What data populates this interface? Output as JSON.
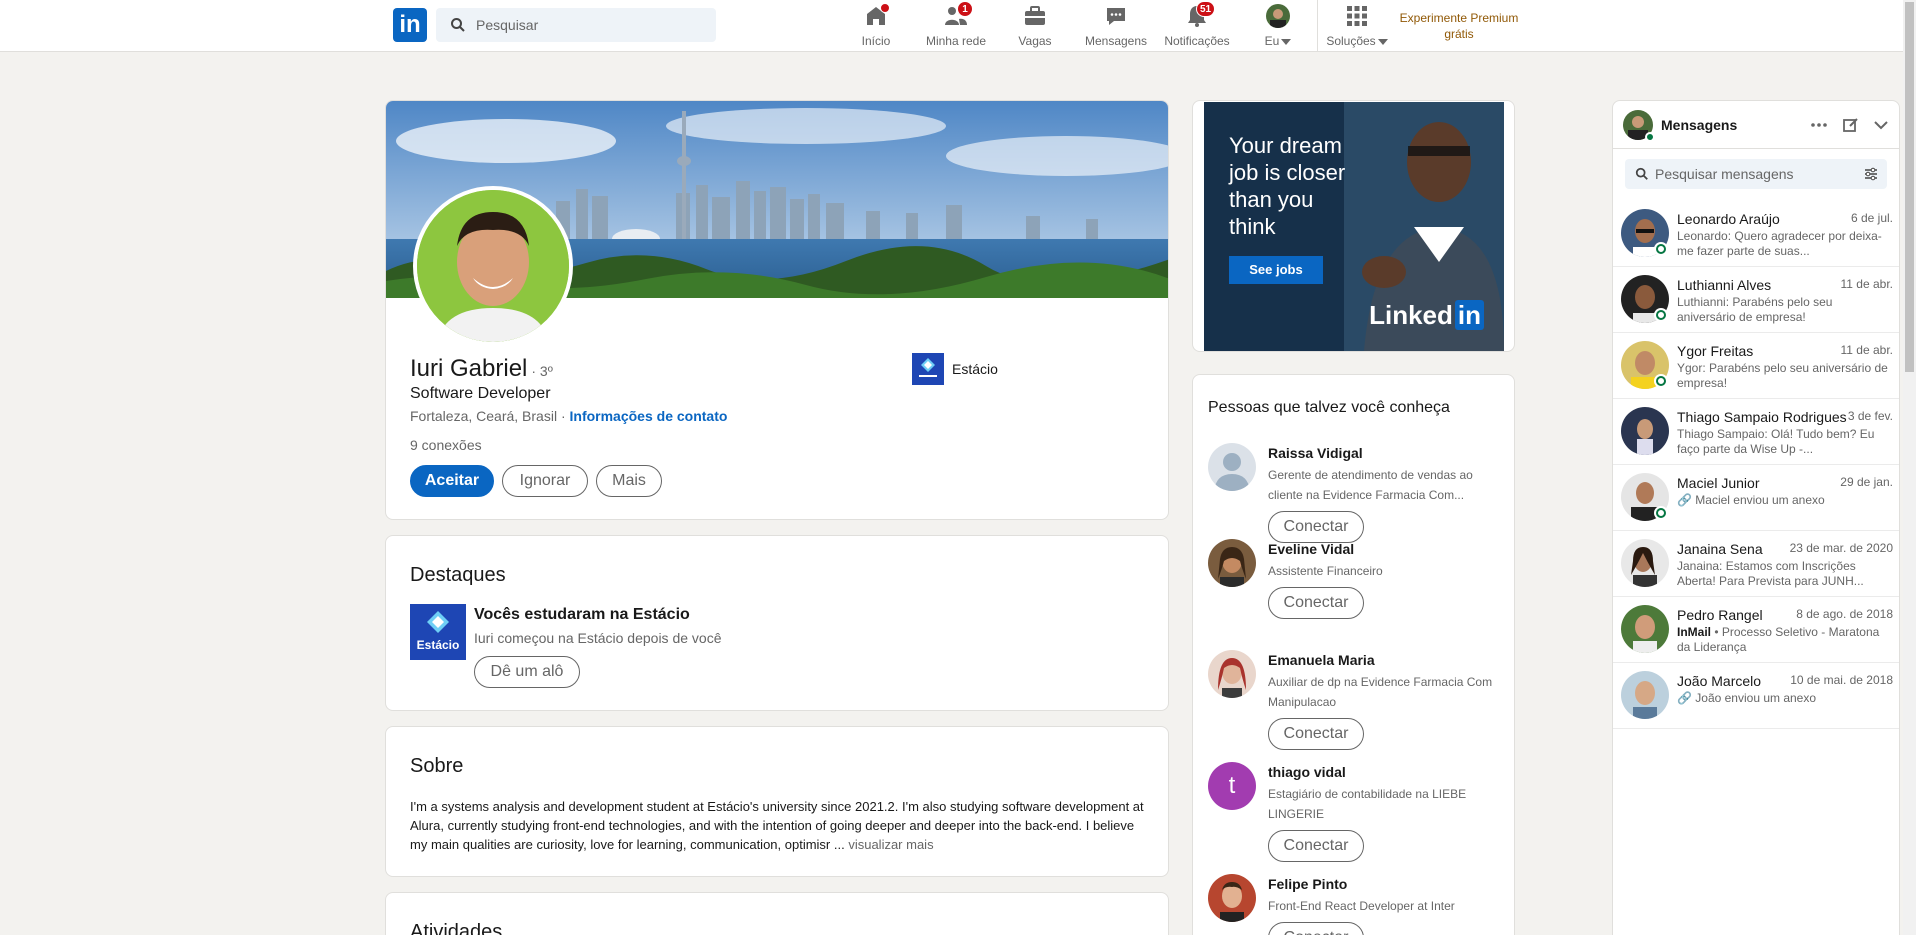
{
  "nav": {
    "logo": "in",
    "search_placeholder": "Pesquisar",
    "items": [
      {
        "label": "Início",
        "badge": ""
      },
      {
        "label": "Minha rede",
        "badge": "1"
      },
      {
        "label": "Vagas",
        "badge": ""
      },
      {
        "label": "Mensagens",
        "badge": ""
      },
      {
        "label": "Notificações",
        "badge": "51"
      },
      {
        "label": "Eu",
        "badge": ""
      },
      {
        "label": "Soluções",
        "badge": ""
      }
    ],
    "premium_line1": "Experimente Premium",
    "premium_line2": "grátis"
  },
  "profile": {
    "name": "Iuri Gabriel",
    "degree": "· 3º",
    "headline": "Software Developer",
    "location": "Fortaleza, Ceará, Brasil ·",
    "contact_link": "Informações de contato",
    "connections": "9 conexões",
    "company": "Estácio",
    "buttons": {
      "accept": "Aceitar",
      "ignore": "Ignorar",
      "more": "Mais"
    }
  },
  "highlights": {
    "title": "Destaques",
    "logo_text": "Estácio",
    "item_title": "Vocês estudaram na Estácio",
    "item_sub": "Iuri começou na Estácio depois de você",
    "button": "Dê um alô"
  },
  "about": {
    "title": "Sobre",
    "text": "I'm a systems analysis and development student at Estácio's university since 2021.2. I'm also studying software development at Alura, currently studying front-end technologies, and with the intention of going deeper and deeper into the back-end. I believe my main qualities are curiosity, love for learning, communication, optimisr ...",
    "more": "visualizar mais"
  },
  "activities": {
    "title": "Atividades"
  },
  "ad": {
    "text": "Your dream job is closer than you think",
    "button": "See jobs",
    "brand": "Linked",
    "brand_in": "in"
  },
  "pymk": {
    "title": "Pessoas que talvez você conheça",
    "connect_label": "Conectar",
    "people": [
      {
        "name": "Raissa Vidigal",
        "desc": "Gerente de atendimento de vendas ao cliente na Evidence Farmacia Com..."
      },
      {
        "name": "Eveline Vidal",
        "desc": "Assistente Financeiro"
      },
      {
        "name": "Emanuela Maria",
        "desc": "Auxiliar de dp na Evidence Farmacia Com Manipulacao"
      },
      {
        "name": "thiago vidal",
        "desc": "Estagiário de contabilidade na LIEBE LINGERIE",
        "initial": "t"
      },
      {
        "name": "Felipe Pinto",
        "desc": "Front-End React Developer at Inter"
      }
    ]
  },
  "messaging": {
    "title": "Mensagens",
    "search_placeholder": "Pesquisar mensagens",
    "conversations": [
      {
        "name": "Leonardo Araújo",
        "date": "6 de jul.",
        "preview": "Leonardo: Quero agradecer por deixa-me fazer parte de suas...",
        "online": true
      },
      {
        "name": "Luthianni Alves",
        "date": "11 de abr.",
        "preview": "Luthianni: Parabéns pelo seu aniversário de empresa!",
        "online": true
      },
      {
        "name": "Ygor Freitas",
        "date": "11 de abr.",
        "preview": "Ygor: Parabéns pelo seu aniversário de empresa!",
        "online": true
      },
      {
        "name": "Thiago Sampaio Rodrigues",
        "date": "3 de fev.",
        "preview": "Thiago Sampaio: Olá! Tudo bem? Eu faço parte da Wise Up -...",
        "online": false
      },
      {
        "name": "Maciel Junior",
        "date": "29 de jan.",
        "preview": "🔗 Maciel enviou um anexo",
        "online": true
      },
      {
        "name": "Janaina Sena",
        "date": "23 de mar. de 2020",
        "preview": "Janaina: Estamos com Inscrições Aberta! Para Prevista para JUNH...",
        "online": false
      },
      {
        "name": "Pedro Rangel",
        "date": "8 de ago. de 2018",
        "preview_bold": "InMail",
        "preview": " • Processo Seletivo - Maratona da Liderança",
        "online": false
      },
      {
        "name": "João Marcelo",
        "date": "10 de mai. de 2018",
        "preview": "🔗 João enviou um anexo",
        "online": false
      }
    ]
  }
}
